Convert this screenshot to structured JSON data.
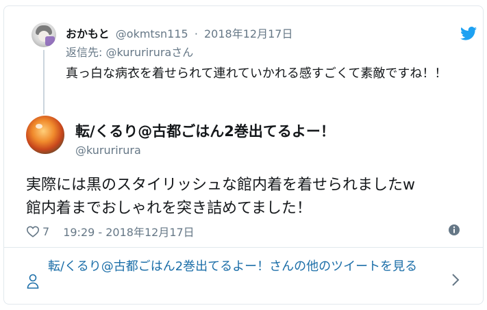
{
  "parent_tweet": {
    "display_name": "おかもと",
    "handle": "@okmtsn115",
    "separator": "·",
    "date": "2018年12月17日",
    "reply_prefix": "返信先: ",
    "reply_to": "@kururirura",
    "reply_suffix": "さん",
    "text": "真っ白な病衣を着せられて連れていかれる感すごくて素敵ですね！！"
  },
  "main_tweet": {
    "display_name": "転/くるり@古都ごはん2巻出てるよー！",
    "handle": "@kururirura",
    "text_line1": "実際には黒のスタイリッシュな館内着を着せられましたw",
    "text_line2": "館内着までおしゃれを突き詰めてました！",
    "like_count": "7",
    "timestamp": "19:29 - 2018年12月17日"
  },
  "footer": {
    "more_tweets_label": "転/くるり@古都ごはん2巻出てるよー！さんの他のツイートを見る"
  },
  "colors": {
    "text": "#14171a",
    "secondary": "#657786",
    "link": "#1b6ea8",
    "twitter_blue": "#1da1f2",
    "border": "#e1e8ed"
  },
  "icons": [
    "twitter-bird-icon",
    "heart-icon",
    "info-icon",
    "person-icon",
    "chevron-right-icon"
  ]
}
